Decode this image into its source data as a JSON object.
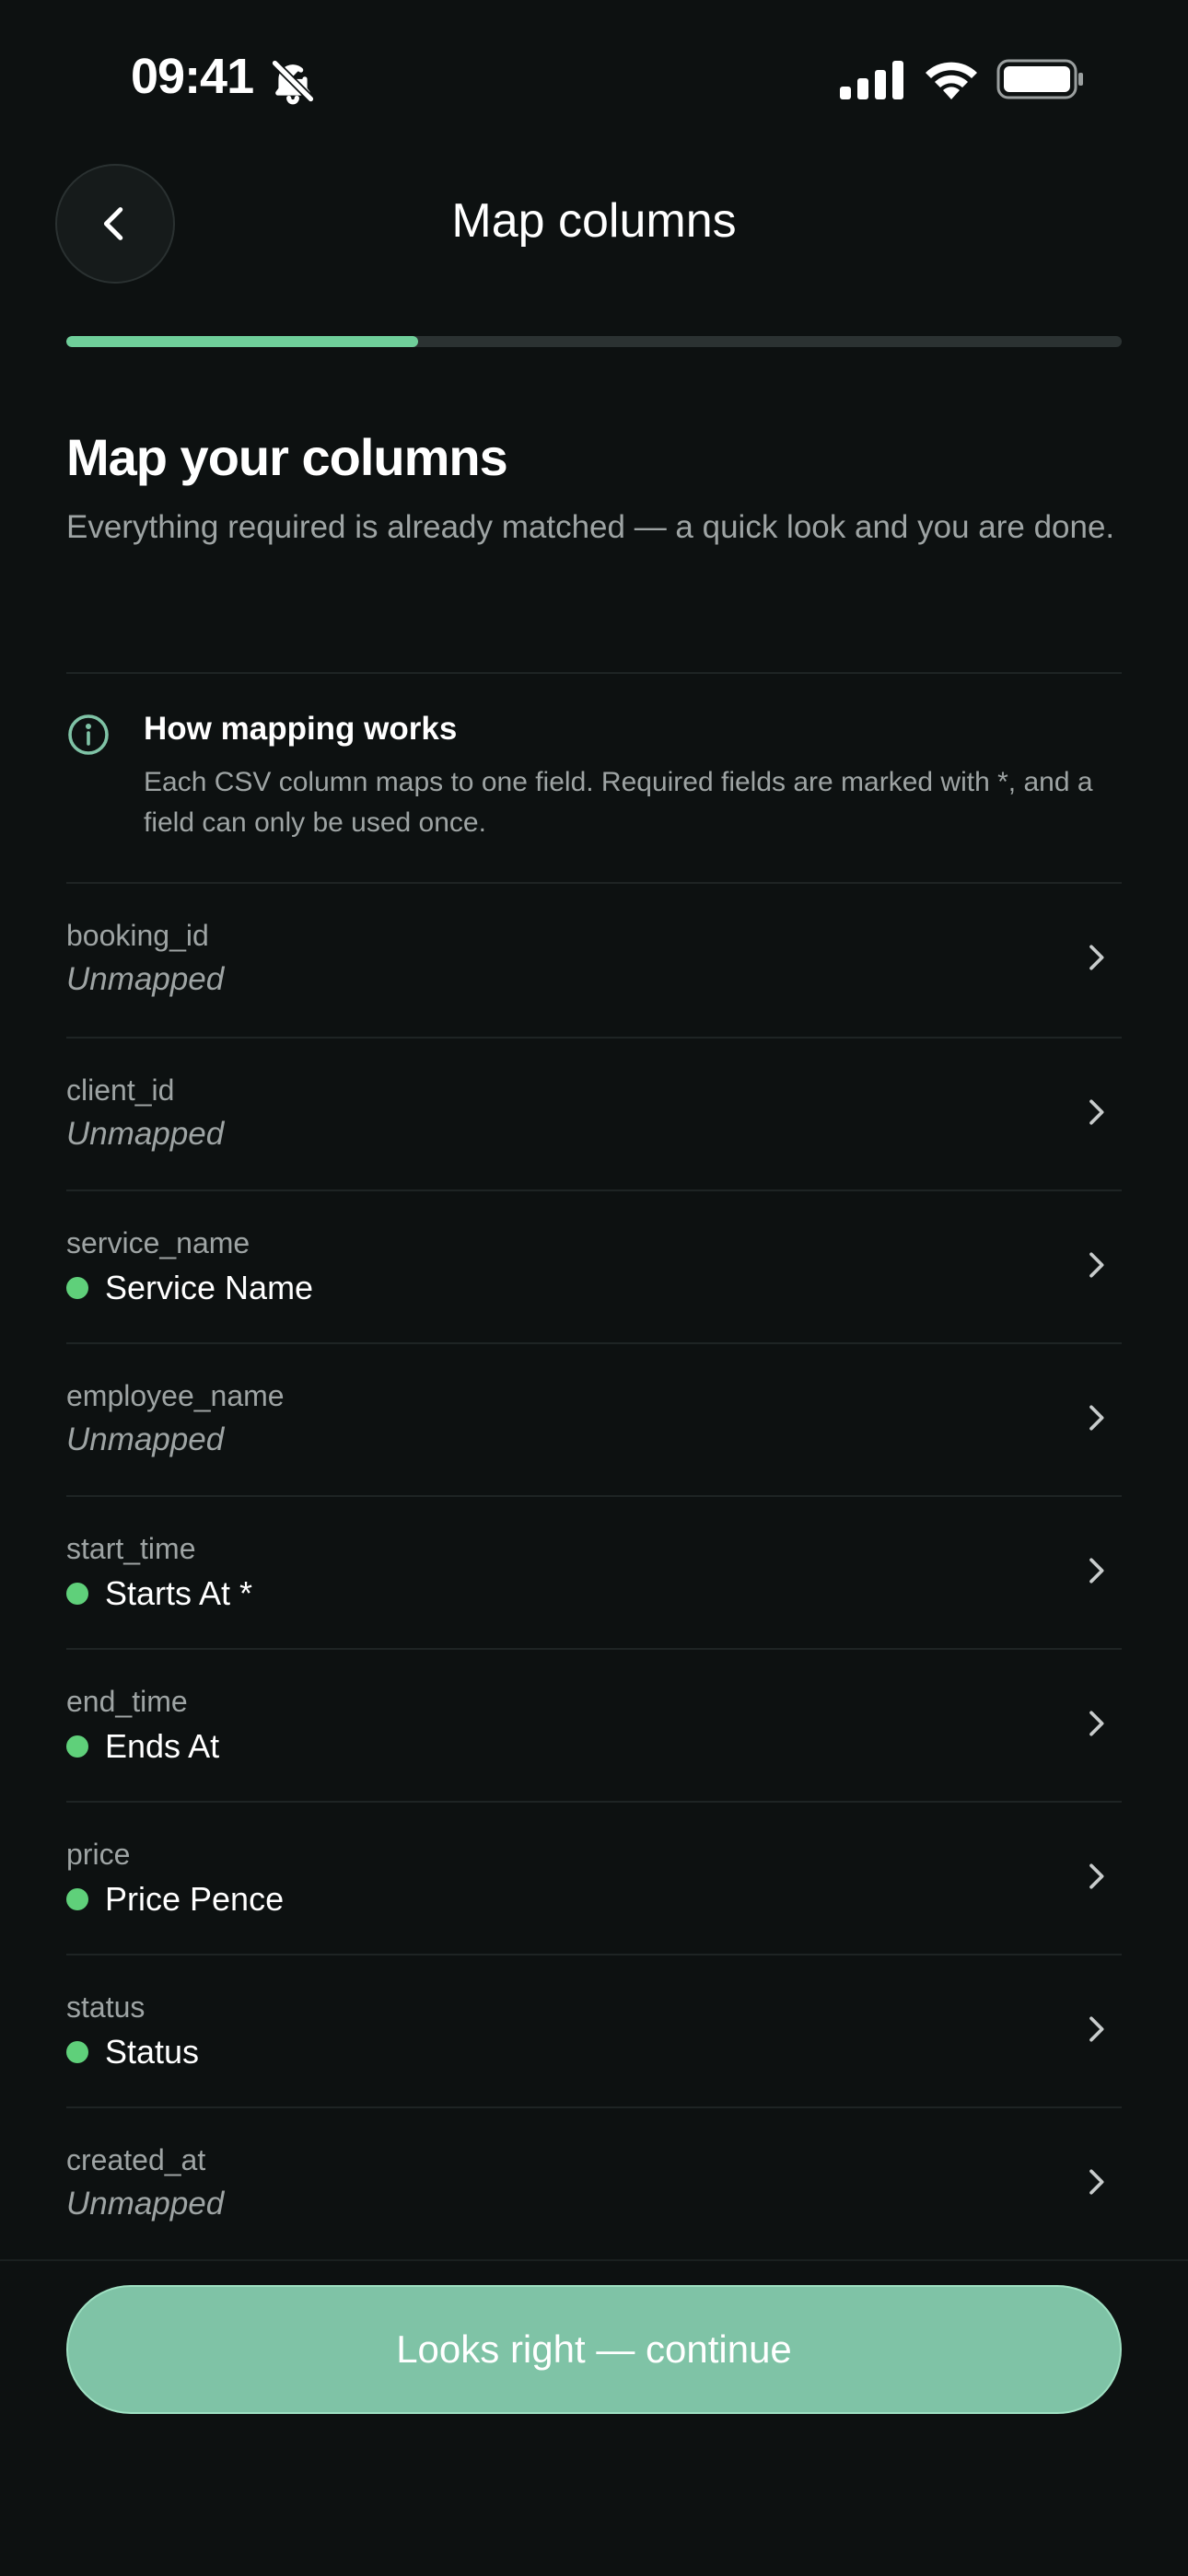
{
  "status_bar": {
    "time": "09:41"
  },
  "header": {
    "title": "Map columns"
  },
  "progress": {
    "fraction": 0.333
  },
  "content": {
    "heading": "Map your columns",
    "subtext": "Everything required is already matched — a quick look and you are done."
  },
  "info": {
    "title": "How mapping works",
    "body": "Each CSV column maps to one field. Required fields are marked with *, and a field can only be used once."
  },
  "rows": [
    {
      "column": "booking_id",
      "field": "Unmapped",
      "mapped": false
    },
    {
      "column": "client_id",
      "field": "Unmapped",
      "mapped": false
    },
    {
      "column": "service_name",
      "field": "Service Name",
      "mapped": true
    },
    {
      "column": "employee_name",
      "field": "Unmapped",
      "mapped": false
    },
    {
      "column": "start_time",
      "field": "Starts At *",
      "mapped": true
    },
    {
      "column": "end_time",
      "field": "Ends At",
      "mapped": true
    },
    {
      "column": "price",
      "field": "Price Pence",
      "mapped": true
    },
    {
      "column": "status",
      "field": "Status",
      "mapped": true
    },
    {
      "column": "created_at",
      "field": "Unmapped",
      "mapped": false
    }
  ],
  "footer": {
    "continue_label": "Looks right — continue"
  },
  "colors": {
    "accent": "#7fc3a6",
    "mapped_dot": "#5fd07a",
    "progress": "#6fcf9a",
    "background": "#0d1111"
  }
}
